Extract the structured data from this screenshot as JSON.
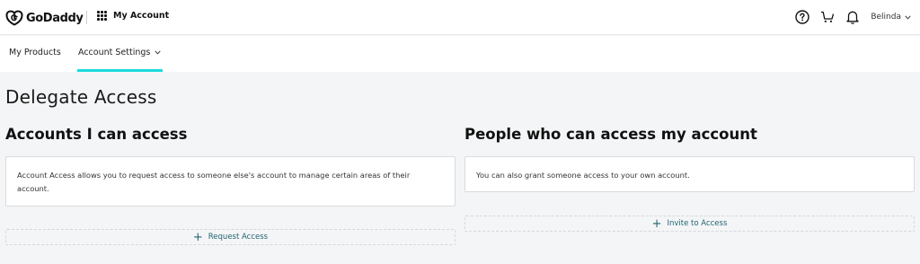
{
  "header": {
    "brand": "GoDaddy",
    "apps_label": "My Account",
    "user_name": "Belinda",
    "icons": [
      "godaddy-logo",
      "apps-grid-icon",
      "help-icon",
      "cart-icon",
      "bell-icon",
      "chevron-down-icon"
    ]
  },
  "subnav": {
    "products_label": "My Products",
    "settings_label": "Account Settings",
    "active": "Account Settings",
    "accent_color": "#1bdbdb"
  },
  "page": {
    "title": "Delegate Access"
  },
  "accounts_i_can_access": {
    "title": "Accounts I can access",
    "description": "Account Access allows you to request access to someone else's account to manage certain areas of their account.",
    "action_label": "Request Access"
  },
  "people_who_can_access": {
    "title": "People who can access my account",
    "description": "You can also grant someone access to your own account.",
    "action_label": "Invite to Access"
  },
  "colors": {
    "background": "#f4f5f7",
    "link": "#21646f"
  }
}
